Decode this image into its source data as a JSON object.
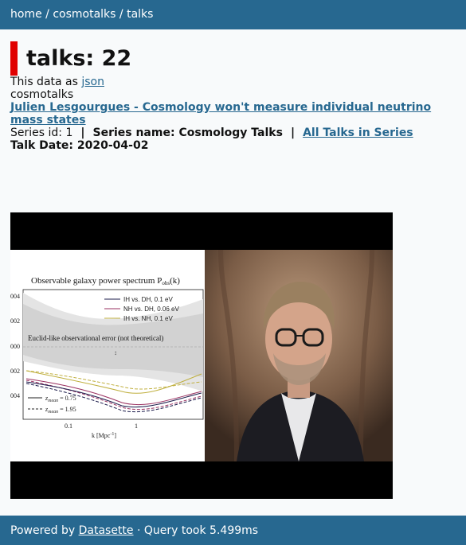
{
  "breadcrumb": {
    "home": "home",
    "sep1": " / ",
    "db": "cosmotalks",
    "sep2": " / ",
    "table": "talks"
  },
  "page_title": "talks: 22",
  "json_line": {
    "prefix": "This data as ",
    "link": "json"
  },
  "series_slug": "cosmotalks",
  "talk_title": "Julien Lesgourgues - Cosmology won't measure individual neutrino mass states",
  "series_line": {
    "id_text": "Series id: 1",
    "pipe1": "|",
    "name_text": "Series name: Cosmology Talks",
    "pipe2": "|",
    "all_link": "All Talks in Series"
  },
  "talk_date": "Talk Date: 2020-04-02",
  "slide": {
    "title": "Observable galaxy power spectrum P",
    "title_sub": "obs",
    "title_suffix": "(k)",
    "legend": [
      "IH vs. DH, 0.1 eV",
      "NH vs. DH, 0.06 eV",
      "IH vs. NH, 0.1 eV"
    ],
    "legend_colors": [
      "#1a1a4a",
      "#9a3060",
      "#c0b040"
    ],
    "band_label": "Euclid-like observational error (not theoretical)",
    "y_ticks": [
      "004",
      "002",
      "000",
      "002",
      "004"
    ],
    "z_legend": [
      "z",
      "mean",
      " = 0.75",
      "z",
      "mean",
      " = 1.95"
    ],
    "x_ticks": [
      "0.1",
      "1"
    ],
    "x_label": "k [Mpc",
    "x_label_sup": "-1",
    "x_label_end": "]"
  },
  "footer": {
    "prefix": "Powered by ",
    "link": "Datasette",
    "suffix": " · Query took 5.499ms"
  },
  "colors": {
    "header_bg": "#276890",
    "accent_bar": "#e00000",
    "link": "#276890"
  }
}
